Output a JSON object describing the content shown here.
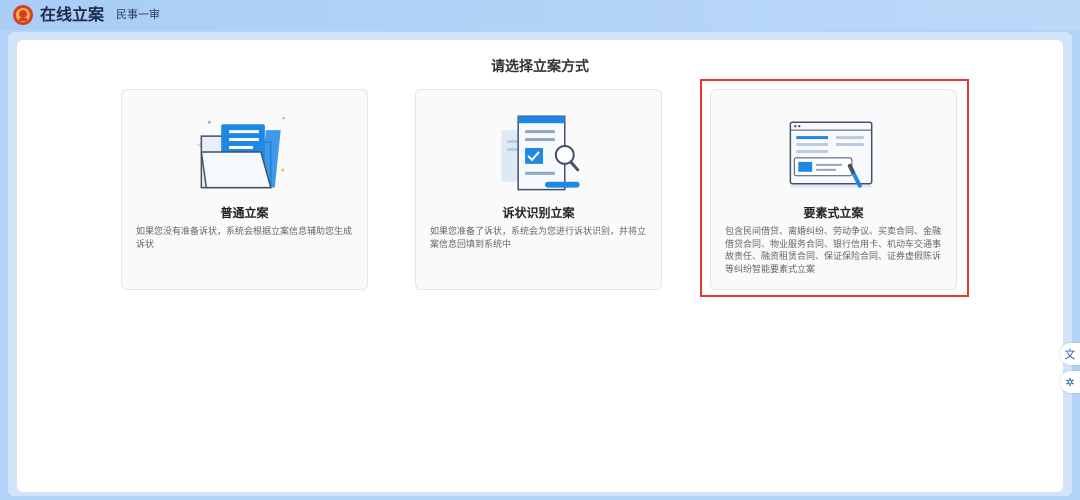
{
  "header": {
    "title": "在线立案",
    "subtitle": "民事一审",
    "emblem_icon": "court-emblem-icon"
  },
  "main": {
    "heading": "请选择立案方式",
    "cards": [
      {
        "title": "普通立案",
        "desc": "如果您没有准备诉状，系统会根据立案信息辅助您生成诉状",
        "icon": "folder-documents-icon"
      },
      {
        "title": "诉状识别立案",
        "desc": "如果您准备了诉状，系统会为您进行诉状识别，并将立案信息回填到系统中",
        "icon": "document-scan-icon"
      },
      {
        "title": "要素式立案",
        "desc": "包含民间借贷、离婚纠纷、劳动争议、买卖合同、金融借贷合同、物业服务合同、银行信用卡、机动车交通事故责任、融资租赁合同、保证保险合同、证券虚假陈诉等纠纷智能要素式立案",
        "icon": "form-screen-pen-icon",
        "highlighted": true
      }
    ]
  },
  "side_tools": [
    {
      "name": "translate-icon",
      "glyph": "文"
    },
    {
      "name": "assistant-icon",
      "glyph": "✲"
    }
  ],
  "colors": {
    "accent_blue": "#1e88e5",
    "highlight_red": "#e53935",
    "topbar": "#a9cdf5"
  }
}
